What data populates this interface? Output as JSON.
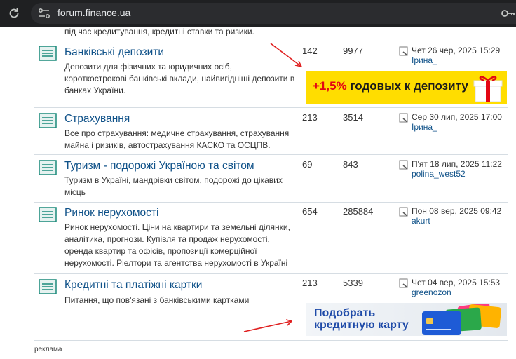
{
  "browser": {
    "url": "forum.finance.ua"
  },
  "top_fragment": "під час кредитування, кредитні ставки та ризики.",
  "forums": [
    {
      "title": "Банківські депозити",
      "description": "Депозити для фізичних та юридичних осіб, короткострокові банківські вклади, найвигідніші депозити в банках України.",
      "topics": "142",
      "posts": "9977",
      "last_post_date": "Чет 26 чер, 2025 15:29",
      "last_post_user": "Ірина_"
    },
    {
      "title": "Страхування",
      "description": "Все про страхування: медичне страхування, страхування майна і ризиків, автострахування КАСКО та ОСЦПВ.",
      "topics": "213",
      "posts": "3514",
      "last_post_date": "Сер 30 лип, 2025 17:00",
      "last_post_user": "Ірина_"
    },
    {
      "title": "Туризм - подорожі Україною та світом",
      "description": "Туризм в Україні, мандрівки світом, подорожі до цікавих місць",
      "topics": "69",
      "posts": "843",
      "last_post_date": "П'ят 18 лип, 2025 11:22",
      "last_post_user": "polina_west52"
    },
    {
      "title": "Ринок нерухомості",
      "description": "Ринок нерухомості. Ціни на квартири та земельні ділянки, аналітика, прогнози. Купівля та продаж нерухомості, оренда квартир та офісів, пропозиції комерційної нерухомості. Ріелтори та агентства нерухомості в Україні",
      "topics": "654",
      "posts": "285884",
      "last_post_date": "Пон 08 вер, 2025 09:42",
      "last_post_user": "akurt"
    },
    {
      "title": "Кредитні та платіжні картки",
      "description": "Питання, що пов'язані з банківськими картками",
      "topics": "213",
      "posts": "5339",
      "last_post_date": "Чет 04 вер, 2025 15:53",
      "last_post_user": "greenozon"
    }
  ],
  "ads": {
    "deposit_banner": {
      "highlight": "+1,5%",
      "text": "годовых к депозиту"
    },
    "card_banner": {
      "line1": "Подобрать",
      "line2": "кредитную карту"
    },
    "label": "реклама"
  },
  "colors": {
    "link": "#105289",
    "ad_yellow": "#ffdd00",
    "ad_red": "#e30613",
    "annotation_arrow": "#e02020"
  }
}
